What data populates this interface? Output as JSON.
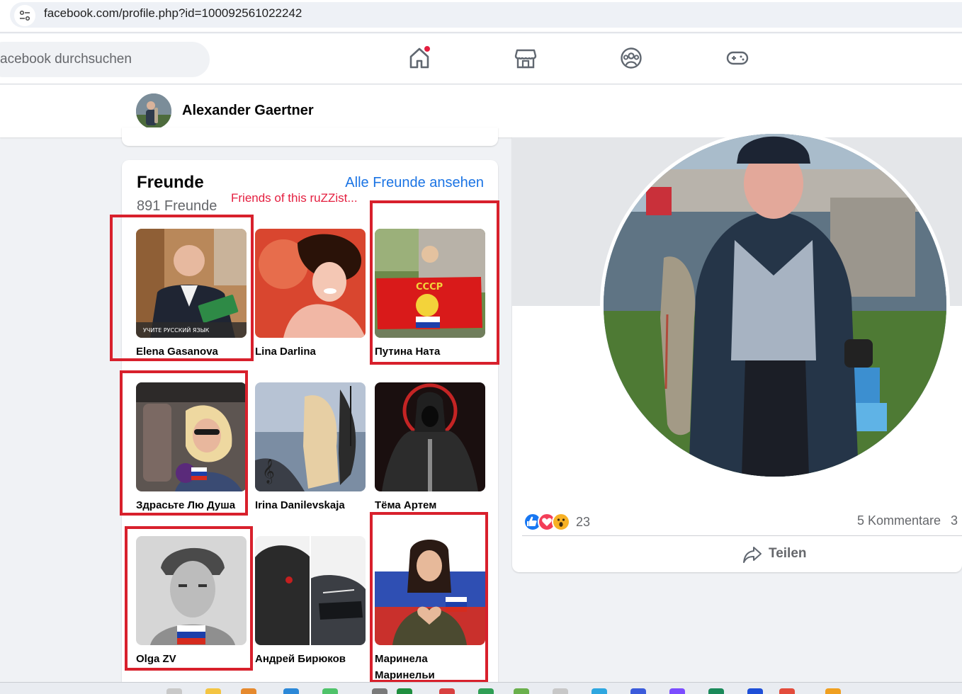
{
  "browser": {
    "url": "facebook.com/profile.php?id=100092561022242"
  },
  "topnav": {
    "search_placeholder": "acebook durchsuchen",
    "icons": [
      "home-icon",
      "marketplace-icon",
      "groups-icon",
      "gaming-icon"
    ],
    "home_has_notification": true
  },
  "profile_header": {
    "name": "Alexander Gaertner"
  },
  "friends": {
    "title": "Freunde",
    "count_label": "891 Freunde",
    "see_all_label": "Alle Freunde ansehen",
    "annotation": "Friends of this ruZZist...",
    "items": [
      {
        "name": "Elena Gasanova",
        "highlighted": true
      },
      {
        "name": "Lina Darlina",
        "highlighted": false
      },
      {
        "name": "Путина Ната",
        "highlighted": true
      },
      {
        "name": "Здрасьте Лю Душа",
        "highlighted": true
      },
      {
        "name": "Irina Danilevskaja",
        "highlighted": false
      },
      {
        "name": "Тёма Артем",
        "highlighted": false
      },
      {
        "name": "Olga ZV",
        "highlighted": true
      },
      {
        "name": "Андрей Бирюков",
        "highlighted": false
      },
      {
        "name": "Маринела Маринельи",
        "highlighted": true
      }
    ],
    "photo_overlays": {
      "elena_caption": "УЧИТЕ РУССКИЙ ЯЗЫК",
      "nata_flag_text": "СССР"
    }
  },
  "post": {
    "reactions": [
      "like",
      "love",
      "wow"
    ],
    "reaction_count": "23",
    "comments_label": "5 Kommentare",
    "shares_partial": "3",
    "share_label": "Teilen"
  },
  "colors": {
    "facebook_blue": "#1b74e4",
    "annotation_red": "#e41e3f",
    "highlight_box": "#d8202c",
    "page_bg": "#f0f2f5"
  }
}
